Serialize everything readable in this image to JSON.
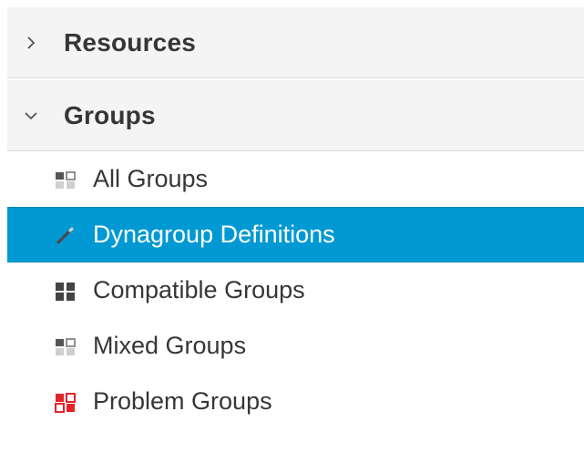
{
  "sections": {
    "resources": {
      "label": "Resources",
      "expanded": false,
      "icon": "chevron-right-icon"
    },
    "groups": {
      "label": "Groups",
      "expanded": true,
      "icon": "chevron-down-icon"
    }
  },
  "groups_items": [
    {
      "label": "All Groups",
      "icon": "mixed-groups-icon",
      "active": false
    },
    {
      "label": "Dynagroup Definitions",
      "icon": "pencil-icon",
      "active": true
    },
    {
      "label": "Compatible Groups",
      "icon": "compatible-groups-icon",
      "active": false
    },
    {
      "label": "Mixed Groups",
      "icon": "mixed-groups-icon",
      "active": false
    },
    {
      "label": "Problem Groups",
      "icon": "problem-groups-icon",
      "active": false
    }
  ],
  "colors": {
    "active_bg": "#0099d3",
    "header_bg": "#f4f4f4",
    "problem_red": "#e3242b",
    "icon_gray": "#555555"
  }
}
